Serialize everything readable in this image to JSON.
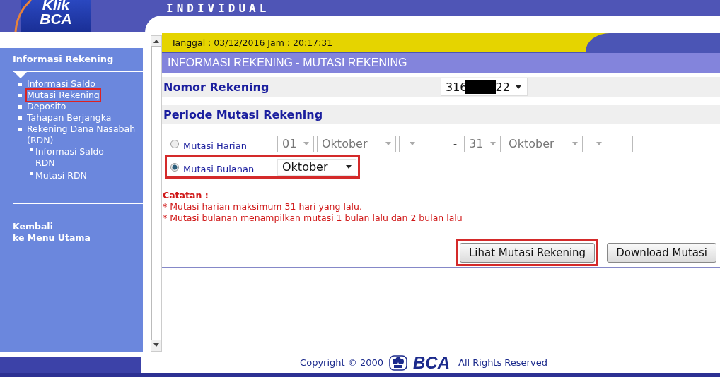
{
  "header": {
    "logo": {
      "line1": "Klik",
      "line2": "BCA"
    },
    "title": "INDIVIDUAL"
  },
  "sidebar": {
    "heading": "Informasi Rekening",
    "items": [
      {
        "label": "Informasi Saldo",
        "highlighted": false
      },
      {
        "label": "Mutasi Rekening",
        "highlighted": true
      },
      {
        "label": "Deposito",
        "highlighted": false
      },
      {
        "label": "Tahapan Berjangka",
        "highlighted": false
      },
      {
        "label": "Rekening Dana Nasabah (RDN)",
        "highlighted": false,
        "children": [
          {
            "label": "Informasi Saldo RDN",
            "highlighted": false
          },
          {
            "label": "Mutasi RDN",
            "highlighted": false
          }
        ]
      }
    ],
    "back_link": "Kembali\nke Menu Utama"
  },
  "date_bar": "Tanggal : 03/12/2016 Jam : 20:17:31",
  "page_title": "INFORMASI REKENING - MUTASI REKENING",
  "account": {
    "label": "Nomor Rekening",
    "prefix": "316",
    "suffix": "22"
  },
  "period": {
    "heading": "Periode Mutasi Rekening",
    "options": [
      {
        "kind": "daily",
        "label": "Mutasi Harian",
        "selected": false,
        "highlighted": false,
        "disabled": true,
        "from": [
          {
            "value": "01",
            "kind": "day"
          },
          {
            "value": "Oktober",
            "kind": "month"
          },
          {
            "kind": "year"
          }
        ],
        "separator": "-",
        "to": [
          {
            "value": "31",
            "kind": "day"
          },
          {
            "value": "Oktober",
            "kind": "month"
          },
          {
            "kind": "year"
          }
        ]
      },
      {
        "kind": "monthly",
        "label": "Mutasi Bulanan",
        "selected": true,
        "highlighted": true,
        "disabled": false,
        "month": "Oktober"
      }
    ]
  },
  "notes": {
    "heading": "Catatan :",
    "lines": [
      "* Mutasi harian maksimum 31 hari yang lalu.",
      "* Mutasi bulanan menampilkan mutasi 1 bulan lalu dan 2 bulan lalu"
    ]
  },
  "buttons": [
    {
      "label": "Lihat Mutasi Rekening",
      "highlighted": true
    },
    {
      "label": "Download Mutasi",
      "highlighted": false
    }
  ],
  "footer": {
    "copyright": "Copyright © 2000",
    "brand": "BCA",
    "rights": "All Rights Reserved"
  }
}
